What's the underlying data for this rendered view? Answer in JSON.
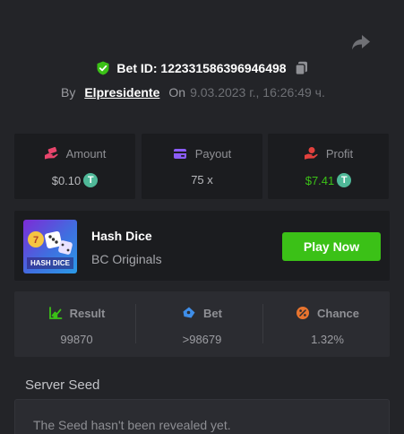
{
  "header": {
    "bet_id_label": "Bet ID: 122331586396946498",
    "by_label": "By",
    "username": "Elpresidente",
    "on_label": "On",
    "date": "9.03.2023 г., 16:26:49 ч."
  },
  "stats": {
    "amount": {
      "label": "Amount",
      "value": "$0.10",
      "coin": "T"
    },
    "payout": {
      "label": "Payout",
      "value": "75 x"
    },
    "profit": {
      "label": "Profit",
      "value": "$7.41",
      "coin": "T"
    }
  },
  "game": {
    "name": "Hash Dice",
    "provider": "BC Originals",
    "thumb_text": "HASH DICE",
    "play_label": "Play Now"
  },
  "result": {
    "result": {
      "label": "Result",
      "value": "99870"
    },
    "bet": {
      "label": "Bet",
      "value": ">98679"
    },
    "chance": {
      "label": "Chance",
      "value": "1.32%"
    }
  },
  "seed": {
    "title": "Server Seed",
    "text": "The Seed hasn't been revealed yet."
  },
  "colors": {
    "background": "#232428",
    "card": "#1b1c1f",
    "accent_green": "#3bc117",
    "profit_green": "#3bc117",
    "amount_icon": "#e8456c",
    "payout_icon": "#8b5cf6",
    "profit_icon": "#e2413d",
    "usdt_coin": "#4fb898"
  },
  "icons": {
    "share": "share-arrow-icon",
    "verified": "shield-check-icon",
    "copy": "copy-icon",
    "amount": "money-hand-icon",
    "payout": "wallet-icon",
    "profit": "profit-hand-icon",
    "result": "chart-check-icon",
    "bet": "ticket-icon",
    "chance": "percent-icon"
  }
}
